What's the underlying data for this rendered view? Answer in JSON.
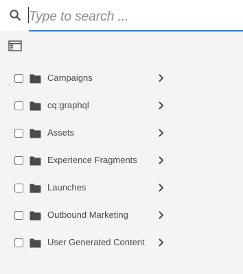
{
  "search": {
    "placeholder": "Type to search ...",
    "value": "",
    "icon": "search-icon",
    "underline_color": "#2680eb"
  },
  "toolbar": {
    "rail_toggle_icon": "rail-toggle-icon"
  },
  "folders": [
    {
      "label": "Campaigns",
      "checked": false,
      "icon": "folder-icon"
    },
    {
      "label": "cq:graphql",
      "checked": false,
      "icon": "folder-icon"
    },
    {
      "label": "Assets",
      "checked": false,
      "icon": "folder-icon"
    },
    {
      "label": "Experience Fragments",
      "checked": false,
      "icon": "folder-icon"
    },
    {
      "label": "Launches",
      "checked": false,
      "icon": "folder-icon"
    },
    {
      "label": "Outbound Marketing",
      "checked": false,
      "icon": "folder-icon"
    },
    {
      "label": "User Generated Content",
      "checked": false,
      "icon": "folder-icon"
    }
  ],
  "colors": {
    "background": "#f4f4f4",
    "text": "#4b4b4b",
    "accent": "#2680eb"
  }
}
